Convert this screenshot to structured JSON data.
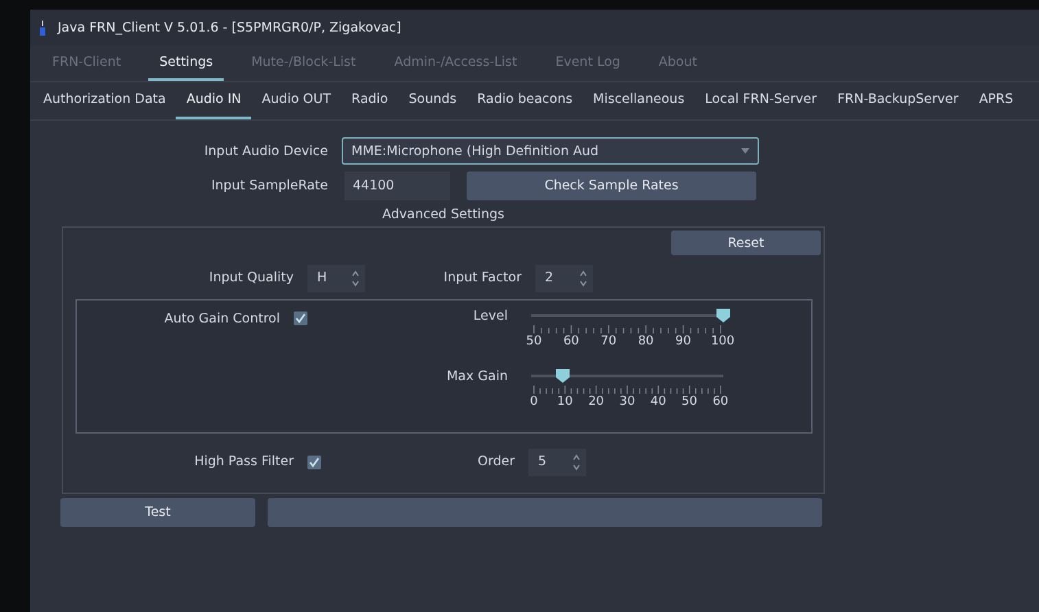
{
  "window": {
    "title": "Java FRN_Client V 5.01.6 - [S5PMRGR0/P, Zigakovac]"
  },
  "main_tabs": [
    {
      "label": "FRN-Client",
      "selected": false
    },
    {
      "label": "Settings",
      "selected": true
    },
    {
      "label": "Mute-/Block-List",
      "selected": false
    },
    {
      "label": "Admin-/Access-List",
      "selected": false
    },
    {
      "label": "Event Log",
      "selected": false
    },
    {
      "label": "About",
      "selected": false
    }
  ],
  "sub_tabs": [
    {
      "label": "Authorization Data",
      "selected": false
    },
    {
      "label": "Audio IN",
      "selected": true
    },
    {
      "label": "Audio OUT",
      "selected": false
    },
    {
      "label": "Radio",
      "selected": false
    },
    {
      "label": "Sounds",
      "selected": false
    },
    {
      "label": "Radio beacons",
      "selected": false
    },
    {
      "label": "Miscellaneous",
      "selected": false
    },
    {
      "label": "Local FRN-Server",
      "selected": false
    },
    {
      "label": "FRN-BackupServer",
      "selected": false
    },
    {
      "label": "APRS",
      "selected": false
    }
  ],
  "input_device": {
    "label": "Input Audio Device",
    "value": "MME:Microphone (High Definition Aud"
  },
  "sample_rate": {
    "label": "Input SampleRate",
    "value": "44100",
    "button": "Check Sample Rates"
  },
  "advanced": {
    "title": "Advanced Settings",
    "reset": "Reset",
    "input_quality": {
      "label": "Input Quality",
      "value": "H"
    },
    "input_factor": {
      "label": "Input Factor",
      "value": "2"
    },
    "auto_gain": {
      "label": "Auto Gain Control",
      "checked": true
    },
    "sliders": [
      {
        "label": "Level",
        "level": 1.0,
        "ticks": [
          "50",
          "60",
          "70",
          "80",
          "90",
          "100"
        ]
      },
      {
        "label": "Max Gain",
        "level": 0.167,
        "ticks": [
          "0",
          "10",
          "20",
          "30",
          "40",
          "50",
          "60"
        ]
      }
    ],
    "high_pass": {
      "label": "High Pass Filter",
      "checked": true
    },
    "order": {
      "label": "Order",
      "value": "5"
    }
  },
  "test_button": "Test",
  "test_progress": {
    "level": 0
  }
}
